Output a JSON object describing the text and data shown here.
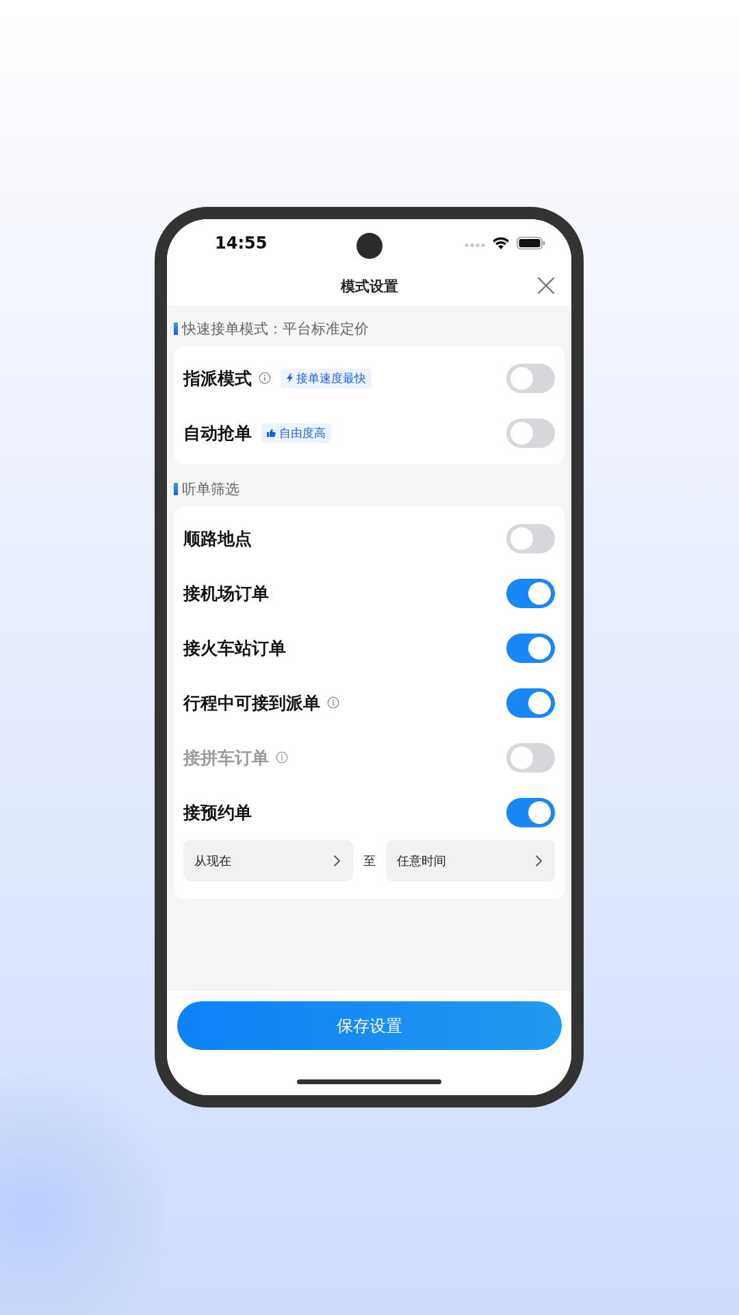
{
  "status_bar": {
    "time": "14:55"
  },
  "header": {
    "title": "模式设置"
  },
  "sections": [
    {
      "heading": "快速接单模式：平台标准定价",
      "rows": [
        {
          "kind": "toggle",
          "label": "指派模式",
          "info": true,
          "tag": {
            "kind": "bolt",
            "text": "接单速度最快"
          },
          "on": false,
          "disabled": false
        },
        {
          "kind": "toggle",
          "label": "自动抢单",
          "info": false,
          "tag": {
            "kind": "thumb",
            "text": "自由度高"
          },
          "on": false,
          "disabled": false
        }
      ]
    },
    {
      "heading": "听单筛选",
      "rows": [
        {
          "kind": "toggle",
          "label": "顺路地点",
          "info": false,
          "on": false,
          "disabled": false
        },
        {
          "kind": "toggle",
          "label": "接机场订单",
          "info": false,
          "on": true,
          "disabled": false
        },
        {
          "kind": "toggle",
          "label": "接火车站订单",
          "info": false,
          "on": true,
          "disabled": false
        },
        {
          "kind": "toggle",
          "label": "行程中可接到派单",
          "info": true,
          "on": true,
          "disabled": false
        },
        {
          "kind": "toggle",
          "label": "接拼车订单",
          "info": true,
          "on": false,
          "disabled": true
        },
        {
          "kind": "toggle",
          "label": "接预约单",
          "info": false,
          "on": true,
          "disabled": false
        },
        {
          "kind": "range",
          "from": "从现在",
          "separator": "至",
          "to": "任意时间"
        }
      ]
    }
  ],
  "save_button": "保存设置"
}
